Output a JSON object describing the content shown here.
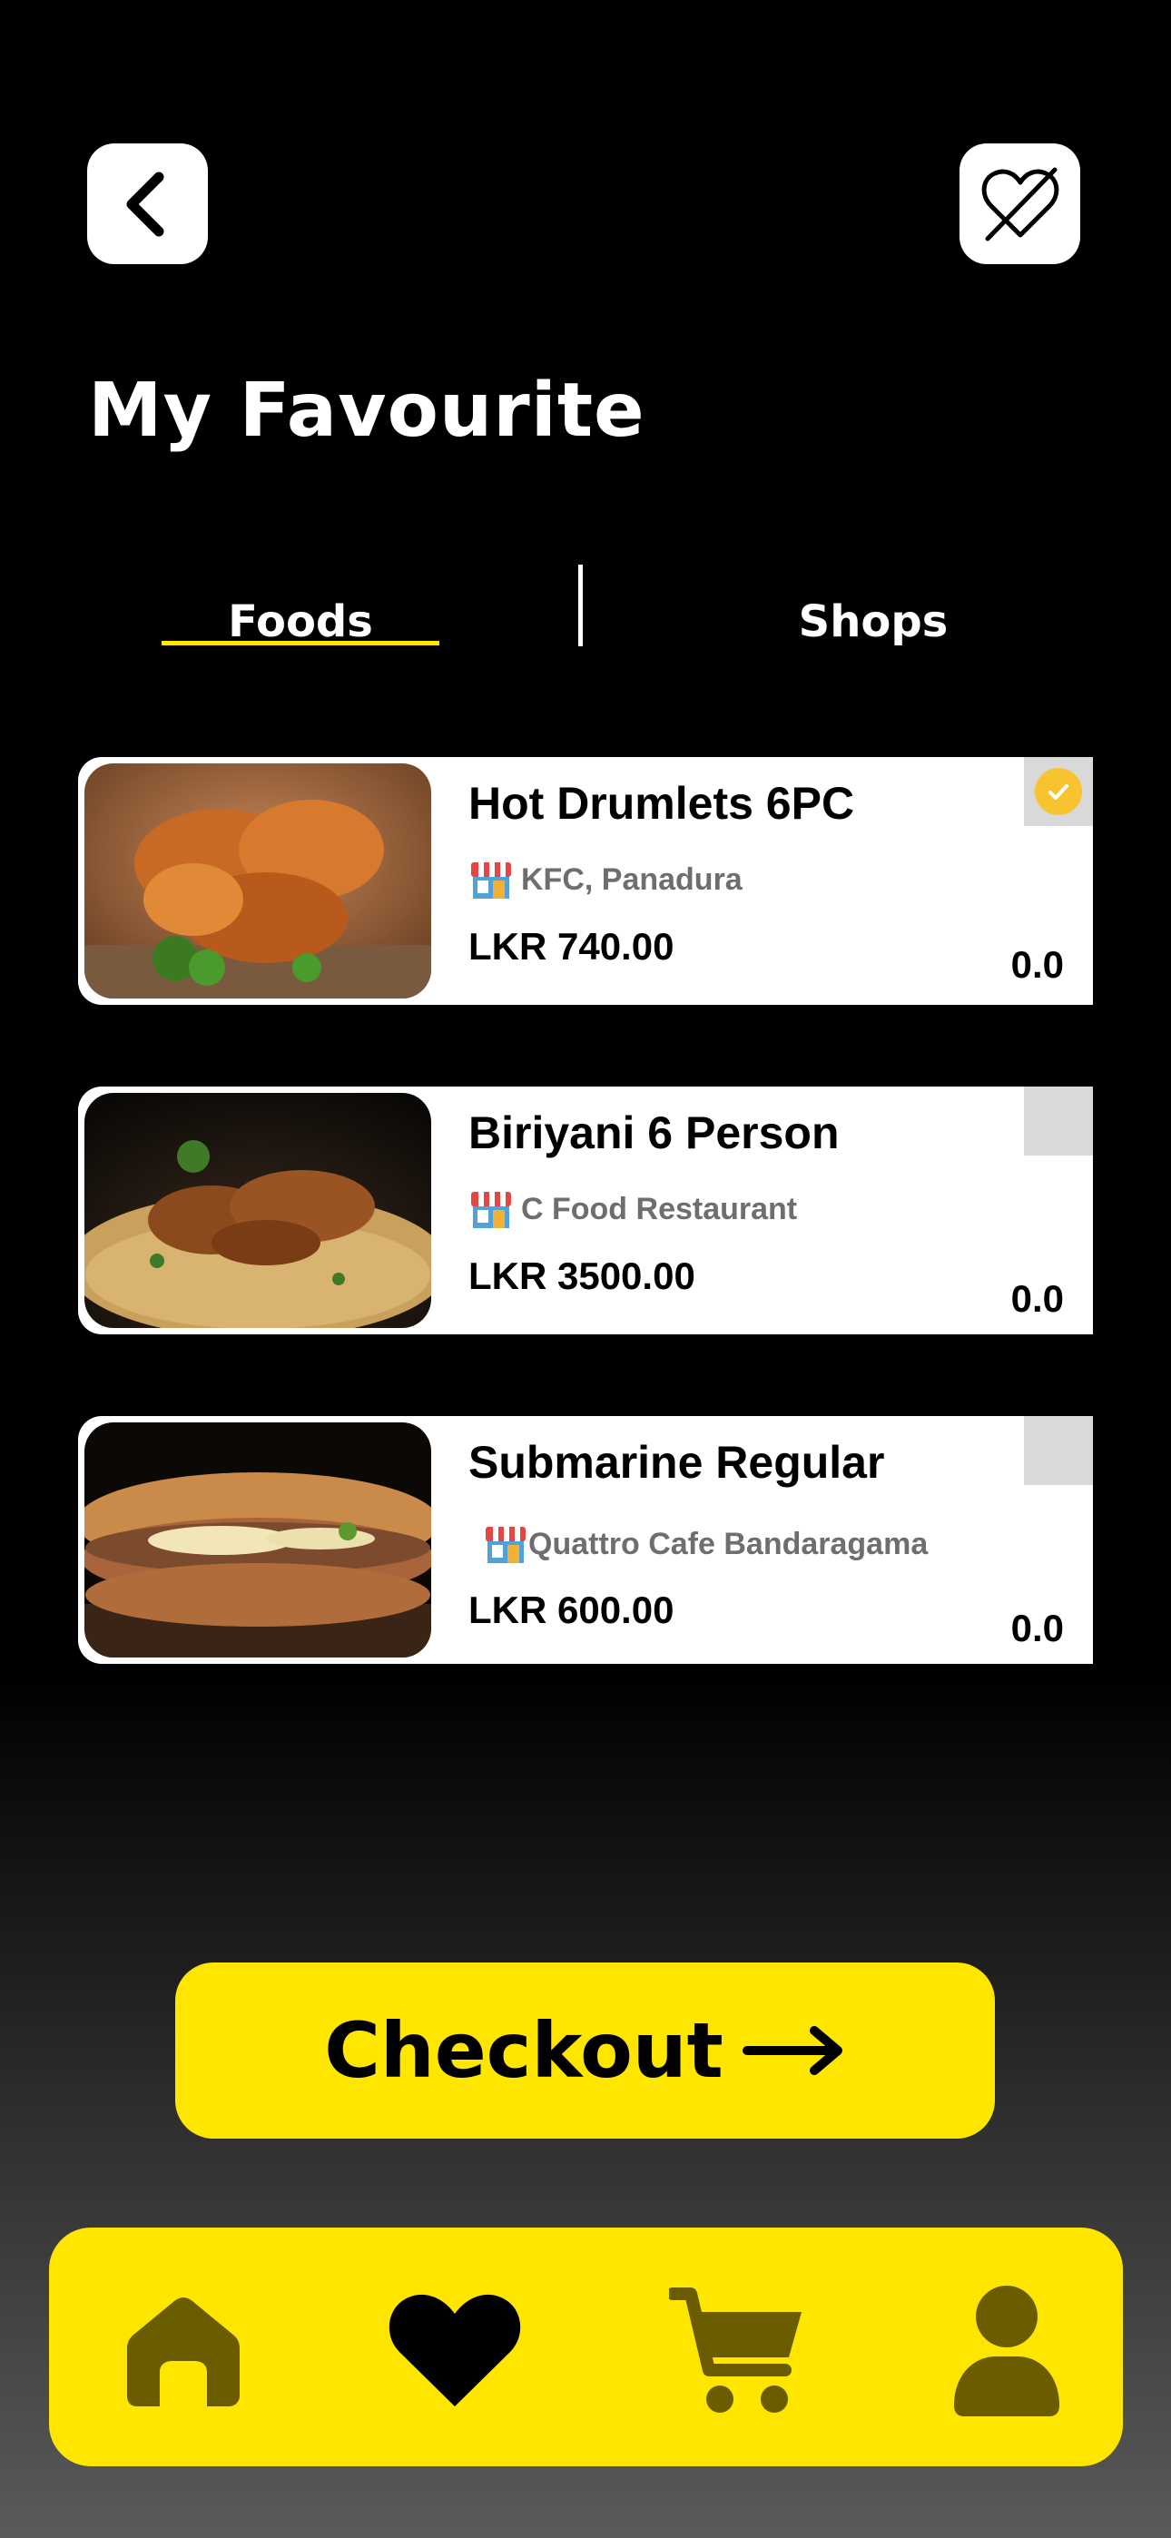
{
  "header": {
    "title": "My Favourite",
    "back_icon": "chevron-left-icon",
    "unfavourite_icon": "heart-off-icon"
  },
  "tabs": [
    {
      "label": "Foods",
      "active": true
    },
    {
      "label": "Shops",
      "active": false
    }
  ],
  "favourites": [
    {
      "name": "Hot Drumlets 6PC",
      "shop": "KFC, Panadura",
      "price": "LKR 740.00",
      "rating": "0.0",
      "selected": true,
      "image": "fried-chicken-photo"
    },
    {
      "name": "Biriyani 6 Person",
      "shop": "C Food Restaurant",
      "price": "LKR 3500.00",
      "rating": "0.0",
      "selected": false,
      "image": "biriyani-photo"
    },
    {
      "name": "Submarine Regular",
      "shop": "Quattro Cafe Bandaragama",
      "price": "LKR 600.00",
      "rating": "0.0",
      "selected": false,
      "image": "submarine-photo"
    }
  ],
  "checkout": {
    "label": "Checkout",
    "icon": "arrow-right-icon"
  },
  "bottom_nav": [
    {
      "icon": "home-icon",
      "active": false
    },
    {
      "icon": "heart-icon",
      "active": true
    },
    {
      "icon": "cart-icon",
      "active": false
    },
    {
      "icon": "profile-icon",
      "active": false
    }
  ],
  "colors": {
    "accent": "#ffe600",
    "check": "#f7c32e",
    "nav_inactive": "#6b5c00",
    "nav_active": "#000000"
  }
}
